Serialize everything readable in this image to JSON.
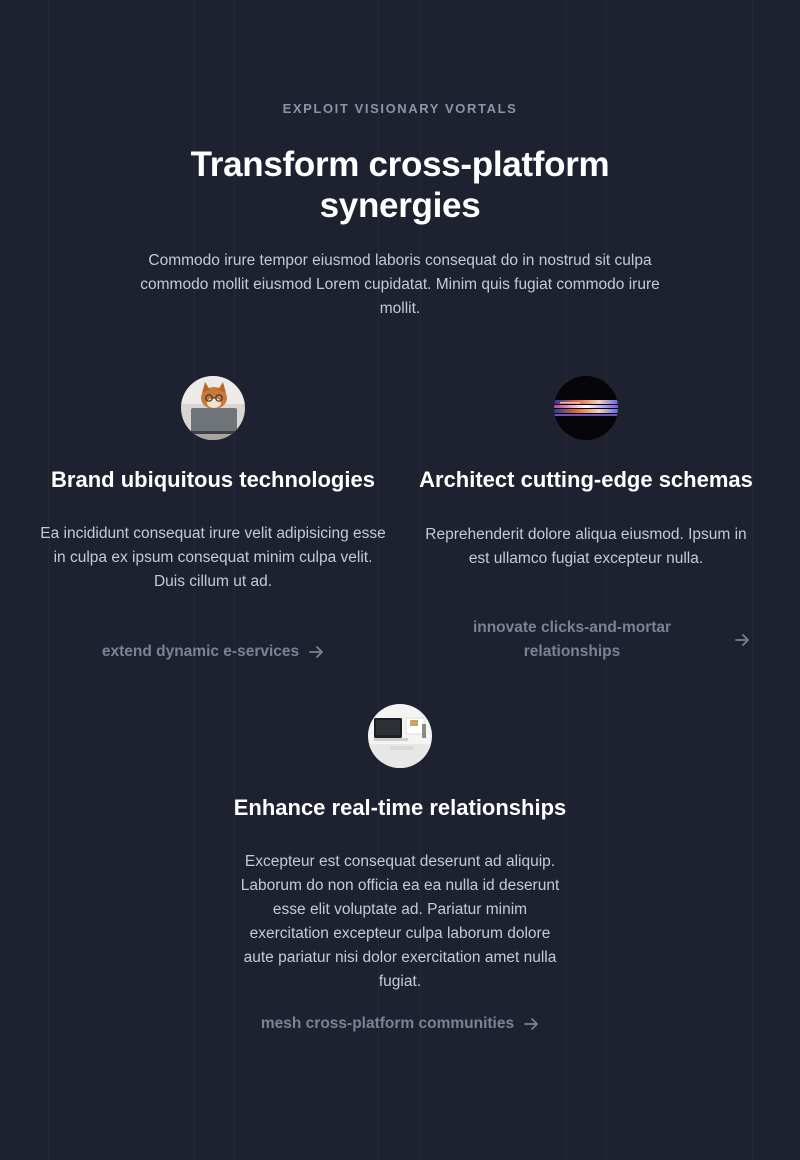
{
  "header": {
    "eyebrow": "EXPLOIT VISIONARY VORTALS",
    "title": "Transform cross-platform synergies",
    "description": "Commodo irure tempor eiusmod laboris consequat do in nostrud sit culpa commodo mollit eiusmod Lorem cupidatat. Minim quis fugiat commodo irure mollit."
  },
  "features": [
    {
      "image": "shiba-dog-laptop-photo",
      "title": "Brand ubiquitous technologies",
      "description": "Ea incididunt consequat irure velit adipisicing esse in culpa ex ipsum consequat minim culpa velit. Duis cillum ut ad.",
      "link": "extend dynamic e-services",
      "link_icon": "arrow-right-icon"
    },
    {
      "image": "abstract-light-streaks-photo",
      "title": "Architect cutting-edge schemas",
      "description": "Reprehenderit dolore aliqua eiusmod. Ipsum in est ullamco fugiat excepteur nulla.",
      "link": "innovate clicks-and-mortar relationships",
      "link_icon": "arrow-right-icon"
    },
    {
      "image": "desk-workspace-photo",
      "title": "Enhance real-time relationships",
      "description": "Excepteur est consequat deserunt ad aliquip. Laborum do non officia ea ea nulla id deserunt esse elit voluptate ad. Pariatur minim exercitation excepteur culpa laborum dolore aute pariatur nisi dolor exercitation amet nulla fugiat.",
      "link": "mesh cross-platform communities",
      "link_icon": "arrow-right-icon"
    }
  ],
  "colors": {
    "background": "#1e2230",
    "heading": "#ffffff",
    "body_text": "#c5cad6",
    "muted": "#8b93a7",
    "link": "#7a8296"
  }
}
